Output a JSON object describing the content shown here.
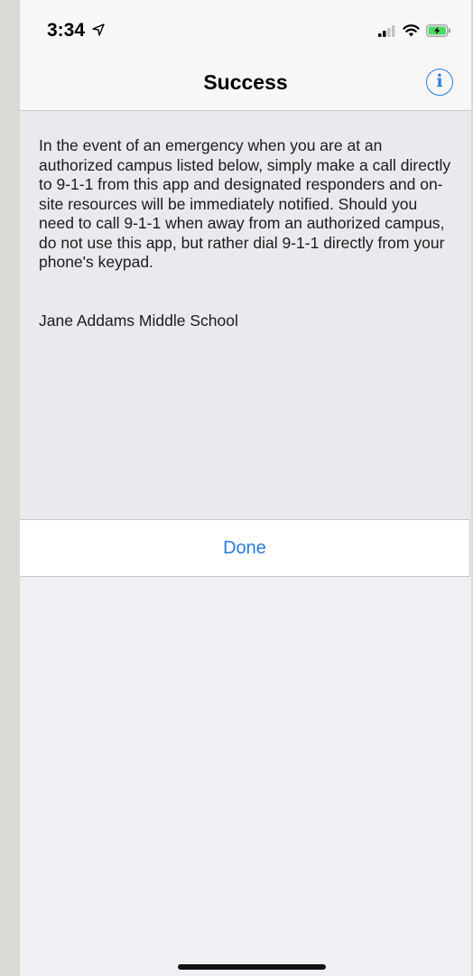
{
  "status_bar": {
    "time": "3:34",
    "icons": [
      "location-arrow-icon",
      "cellular-signal-icon",
      "wifi-icon",
      "battery-charging-icon"
    ]
  },
  "nav_bar": {
    "title": "Success",
    "info_icon": "info-icon",
    "info_glyph": "i"
  },
  "content": {
    "message": "In the event of an emergency when you are at an authorized campus listed below, simply make a call directly to 9-1-1 from this app and designated responders and on-site resources will be immediately notified. Should you need to call 9-1-1 when away from an authorized campus, do not use this app, but rather dial 9-1-1 directly from your phone's keypad.",
    "campus_name": "Jane Addams Middle School"
  },
  "actions": {
    "done_label": "Done"
  },
  "colors": {
    "accent": "#2a7be0",
    "battery": "#4cd964"
  }
}
